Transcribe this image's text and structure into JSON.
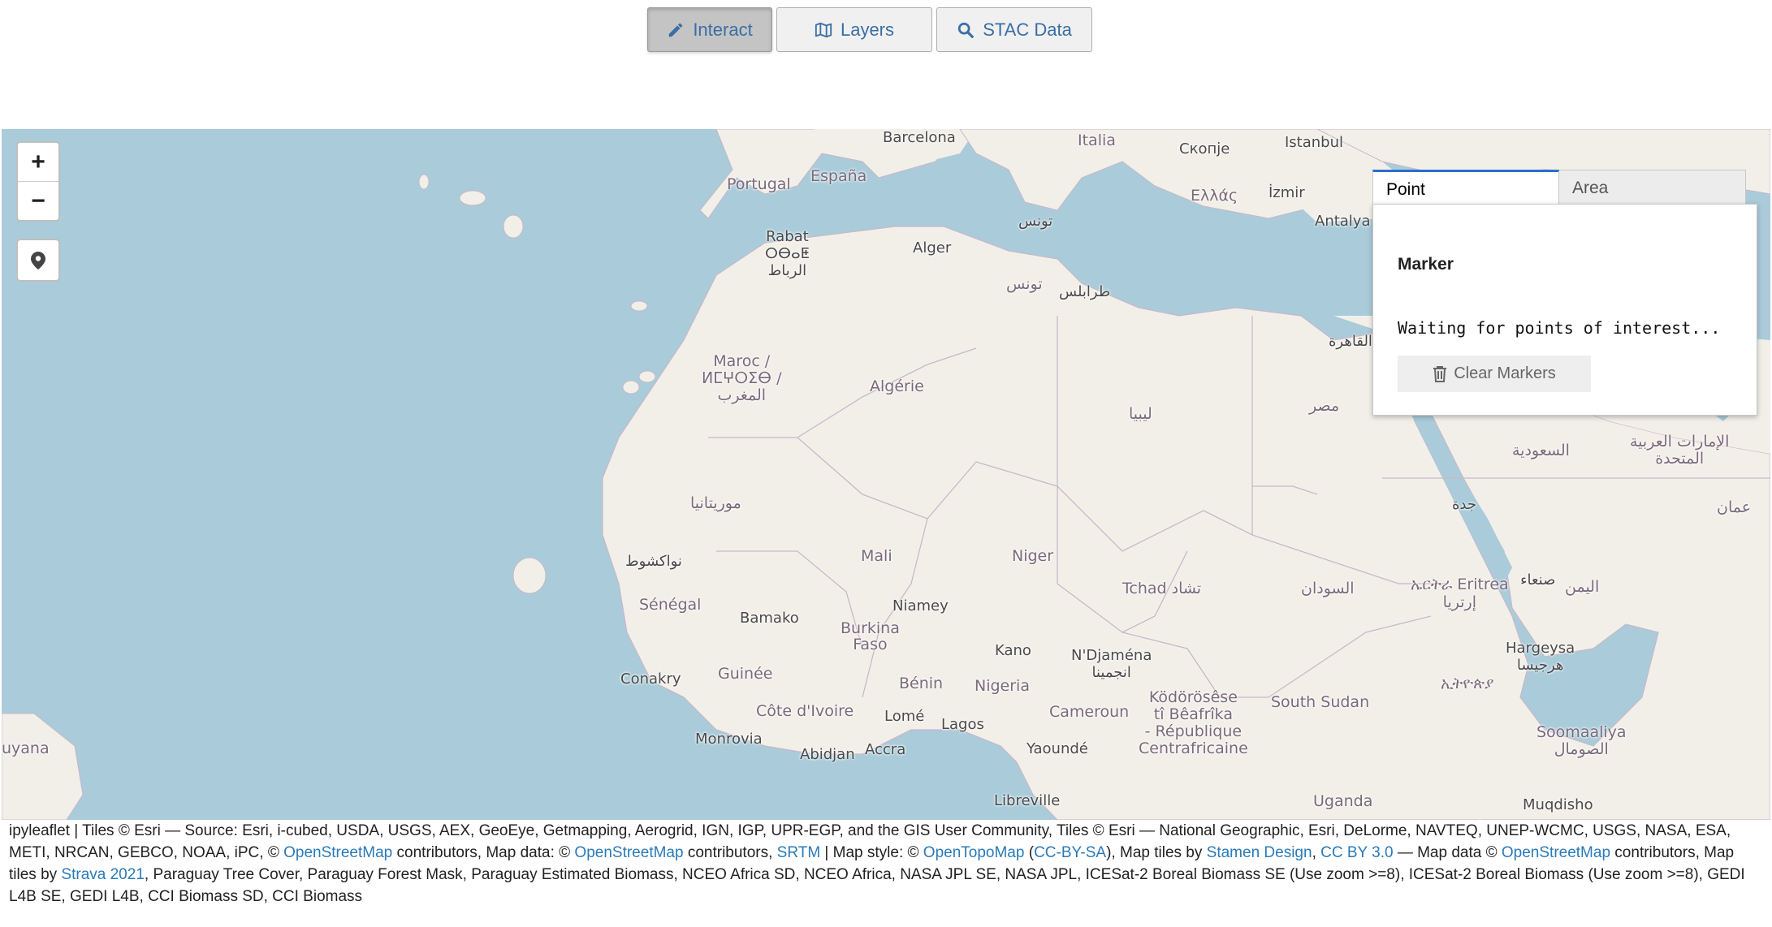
{
  "toolbar": {
    "interact_label": "Interact",
    "layers_label": "Layers",
    "stac_label": "STAC Data"
  },
  "map": {
    "zoom_in": "+",
    "zoom_out": "−",
    "labels": {
      "barcelona": "Barcelona",
      "italia": "Italia",
      "skopje": "Скопје",
      "istanbul": "Istanbul",
      "portugal": "Portugal",
      "espana": "España",
      "ellas": "Ελλάς",
      "izmir": "İzmir",
      "antalya": "Antalya",
      "tunis": "تونس",
      "rabat": "Rabat\nⵔⴱⴰⵟ\nالرباط",
      "alger": "Alger",
      "tunisia": "تونس",
      "tripoli": "طرابلس",
      "cairo": "القاهرة",
      "maroc": "Maroc /\nⵍⵎⵖⵔⵉⴱ /\nالمغرب",
      "algerie": "Algérie",
      "libya": "ليبيا",
      "egypt": "مصر",
      "saudi": "السعودية",
      "uae": "الإمارات العربية\nالمتحدة",
      "mauritania": "موريتانيا",
      "jeddah": "جدة",
      "oman": "عمان",
      "nouakchott": "نواكشوط",
      "mali": "Mali",
      "niger": "Niger",
      "tchad": "Tchad تشاد",
      "sudan": "السودان",
      "eritrea": "ኤርትራ Eritrea\nإرتريا",
      "sanaa": "صنعاء",
      "yemen": "اليمن",
      "senegal": "Sénégal",
      "bamako": "Bamako",
      "burkina": "Burkina\nFaso",
      "niamey": "Niamey",
      "kano": "Kano",
      "ndjamena": "N'Djaména\nانجمينا",
      "hargeysa": "Hargeysa\nهرجيسا",
      "conakry": "Conakry",
      "guinee": "Guinée",
      "benin": "Bénin",
      "nigeria": "Nigeria",
      "ethiopia": "ኢትዮጵያ",
      "kodorosese": "Ködörösêse\ntî Bêafrîka\n- République\nCentrafricaine",
      "southsudan": "South Sudan",
      "cotedivoire": "Côte d'Ivoire",
      "lome": "Lomé",
      "lagos": "Lagos",
      "cameroun": "Cameroun",
      "monrovia": "Monrovia",
      "abidjan": "Abidjan",
      "accra": "Accra",
      "yaounde": "Yaoundé",
      "somalia": "Soomaaliya\nالصومال",
      "guyana": "uyana",
      "libreville": "Libreville",
      "uganda": "Uganda",
      "mogadishu": "Muqdisho"
    }
  },
  "panel": {
    "tab_point": "Point",
    "tab_area": "Area",
    "marker_title": "Marker",
    "waiting_text": "Waiting for points of interest...",
    "clear_label": "Clear Markers"
  },
  "attribution": {
    "part1": "ipyleaflet | Tiles © Esri — Source: Esri, i-cubed, USDA, USGS, AEX, GeoEye, Getmapping, Aerogrid, IGN, IGP, UPR-EGP, and the GIS User Community, Tiles © Esri — National Geographic, Esri, DeLorme, NAVTEQ, UNEP-WCMC, USGS, NASA, ESA, METI, NRCAN, GEBCO, NOAA, iPC, © ",
    "link_osm1": "OpenStreetMap",
    "part2": " contributors, Map data: © ",
    "link_osm2": "OpenStreetMap",
    "part3": " contributors, ",
    "link_srtm": "SRTM",
    "part4": " | Map style: © ",
    "link_opentopo": "OpenTopoMap",
    "part5": " (",
    "link_ccbysa": "CC-BY-SA",
    "part6": "), Map tiles by ",
    "link_stamen": "Stamen Design",
    "part7": ", ",
    "link_ccby3": "CC BY 3.0",
    "part8": " — Map data © ",
    "link_osm3": "OpenStreetMap",
    "part9": " contributors, Map tiles by ",
    "link_strava": "Strava 2021",
    "part10": ", Paraguay Tree Cover, Paraguay Forest Mask, Paraguay Estimated Biomass, NCEO Africa SD, NCEO Africa, NASA JPL SE, NASA JPL, ICESat-2 Boreal Biomass SE (Use zoom >=8), ICESat-2 Boreal Biomass (Use zoom >=8), GEDI L4B SE, GEDI L4B, CCI Biomass SD, CCI Biomass"
  },
  "colors": {
    "ocean": "#aacbd9",
    "land": "#f2efe9",
    "accent": "#2a6fc9",
    "link": "#2a7ab8"
  }
}
